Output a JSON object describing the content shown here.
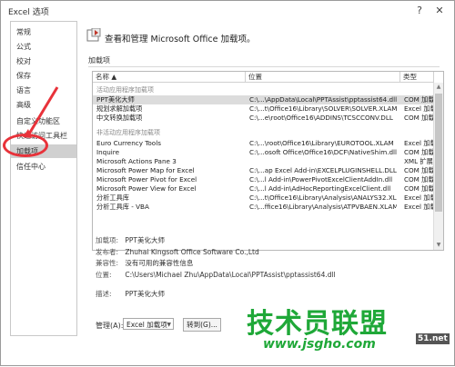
{
  "window": {
    "title": "Excel 选项"
  },
  "sidebar": {
    "items": [
      {
        "label": "常规"
      },
      {
        "label": "公式"
      },
      {
        "label": "校对"
      },
      {
        "label": "保存"
      },
      {
        "label": "语言"
      },
      {
        "label": "高级"
      },
      {
        "label": "自定义功能区"
      },
      {
        "label": "快速访问工具栏"
      },
      {
        "label": "加载项"
      },
      {
        "label": "信任中心"
      }
    ],
    "active_index": 8
  },
  "main": {
    "heading": "查看和管理 Microsoft Office 加载项。",
    "section_title": "加载项",
    "columns": [
      "名称 ▲",
      "位置",
      "类型"
    ],
    "groups": [
      {
        "title": "活动应用程序加载项",
        "rows": [
          {
            "name": "PPT美化大师",
            "location": "C:\\...\\AppData\\Local\\PPTAssist\\pptassist64.dll",
            "type": "COM 加载项",
            "selected": true
          },
          {
            "name": "规划求解加载项",
            "location": "C:\\...t\\Office16\\Library\\SOLVER\\SOLVER.XLAM",
            "type": "Excel 加载项"
          },
          {
            "name": "中文转换加载项",
            "location": "C:\\...e\\root\\Office16\\ADDINS\\TCSCCONV.DLL",
            "type": "COM 加载项"
          }
        ]
      },
      {
        "title": "非活动应用程序加载项",
        "rows": [
          {
            "name": "Euro Currency Tools",
            "location": "C:\\...\\root\\Office16\\Library\\EUROTOOL.XLAM",
            "type": "Excel 加载项"
          },
          {
            "name": "Inquire",
            "location": "C:\\...osoft Office\\Office16\\DCF\\NativeShim.dll",
            "type": "COM 加载项"
          },
          {
            "name": "Microsoft Actions Pane 3",
            "location": "",
            "type": "XML 扩展包"
          },
          {
            "name": "Microsoft Power Map for Excel",
            "location": "C:\\...ap Excel Add-in\\EXCELPLUGINSHELL.DLL",
            "type": "COM 加载项"
          },
          {
            "name": "Microsoft Power Pivot for Excel",
            "location": "C:\\...l Add-in\\PowerPivotExcelClientAddIn.dll",
            "type": "COM 加载项"
          },
          {
            "name": "Microsoft Power View for Excel",
            "location": "C:\\...l Add-in\\AdHocReportingExcelClient.dll",
            "type": "COM 加载项"
          },
          {
            "name": "分析工具库",
            "location": "C:\\...t\\Office16\\Library\\Analysis\\ANALYS32.XLL",
            "type": "Excel 加载项"
          },
          {
            "name": "分析工具库 - VBA",
            "location": "C:\\...ffice16\\Library\\Analysis\\ATPVBAEN.XLAM",
            "type": "Excel 加载项"
          }
        ]
      }
    ],
    "details": {
      "addin_label": "加载项:",
      "addin_value": "PPT美化大师",
      "publisher_label": "发布者:",
      "publisher_value": "Zhuhai Kingsoft Office Software Co.,Ltd",
      "compat_label": "兼容性:",
      "compat_value": "没有可用的兼容性信息",
      "location_label": "位置:",
      "location_value": "C:\\Users\\Michael Zhu\\AppData\\Local\\PPTAssist\\pptassist64.dll",
      "desc_label": "描述:",
      "desc_value": "PPT美化大师"
    },
    "manage": {
      "label": "管理(A):",
      "selected": "Excel 加载项",
      "go_button": "转到(G)..."
    }
  },
  "watermark": {
    "main": "技术员联盟",
    "url": "www.jsgho.com",
    "corner": "51.net"
  },
  "colors": {
    "highlight_ring": "#e8323a",
    "watermark_green": "#1fa838"
  }
}
